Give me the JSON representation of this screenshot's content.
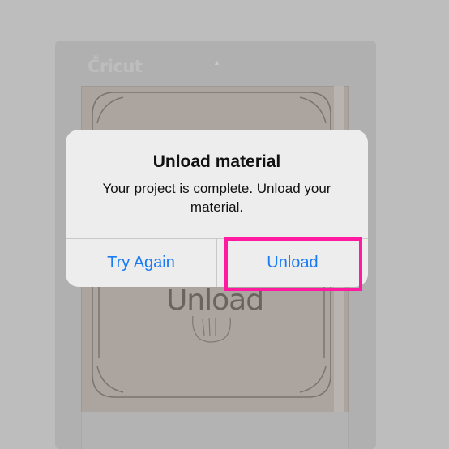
{
  "background": {
    "brand_text": "Cricut",
    "mat_label": "Unload"
  },
  "dialog": {
    "title": "Unload material",
    "message": "Your project is complete. Unload your material.",
    "buttons": {
      "try_again": "Try Again",
      "unload": "Unload"
    }
  },
  "colors": {
    "button_text": "#1a7cf4",
    "highlight": "#ff1aa0",
    "dialog_bg": "#ededed"
  }
}
